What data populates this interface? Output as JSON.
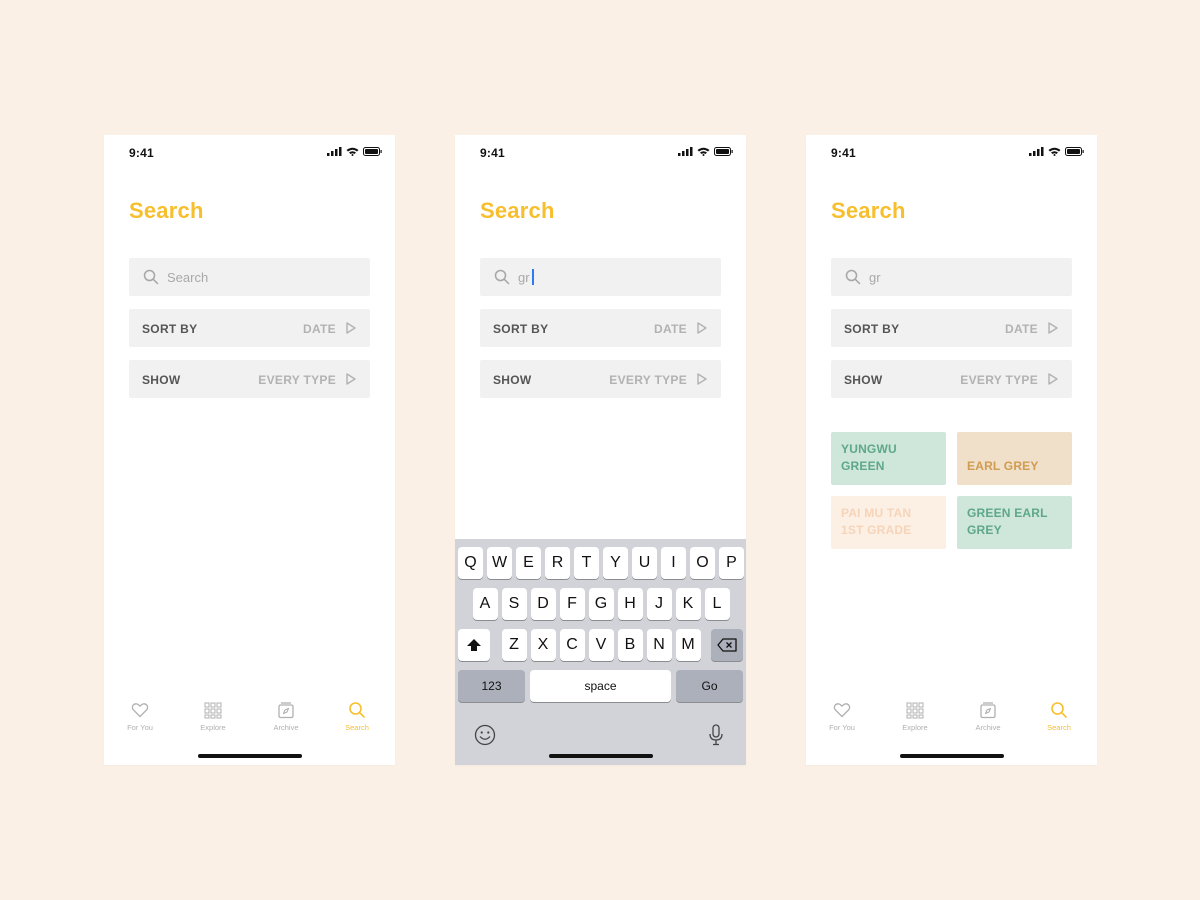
{
  "status": {
    "time": "9:41"
  },
  "page": {
    "title": "Search"
  },
  "search": {
    "placeholder": "Search",
    "typed_value": "gr"
  },
  "filters": {
    "sort": {
      "label": "SORT BY",
      "value": "DATE"
    },
    "show": {
      "label": "SHOW",
      "value": "EVERY TYPE"
    }
  },
  "tabs": [
    {
      "label": "For You",
      "icon": "heart-icon"
    },
    {
      "label": "Explore",
      "icon": "grid-icon"
    },
    {
      "label": "Archive",
      "icon": "archive-box-icon"
    },
    {
      "label": "Search",
      "icon": "search-icon",
      "active": true
    }
  ],
  "keyboard": {
    "row1": [
      "Q",
      "W",
      "E",
      "R",
      "T",
      "Y",
      "U",
      "I",
      "O",
      "P"
    ],
    "row2": [
      "A",
      "S",
      "D",
      "F",
      "G",
      "H",
      "J",
      "K",
      "L"
    ],
    "row3": [
      "Z",
      "X",
      "C",
      "V",
      "B",
      "N",
      "M"
    ],
    "numbers": "123",
    "space": "space",
    "go": "Go"
  },
  "results": [
    {
      "name": "YUNGWU\nGREEN"
    },
    {
      "name": "EARL GREY"
    },
    {
      "name": "PAI MU TAN\n1ST GRADE"
    },
    {
      "name": "GREEN EARL\nGREY"
    }
  ],
  "colors": {
    "background": "#fbf0e6",
    "accent": "#f7bf2e",
    "green_tile": "#cfe6db",
    "tan_tile": "#f0dfc9",
    "peach_tile": "#fcefe4"
  }
}
